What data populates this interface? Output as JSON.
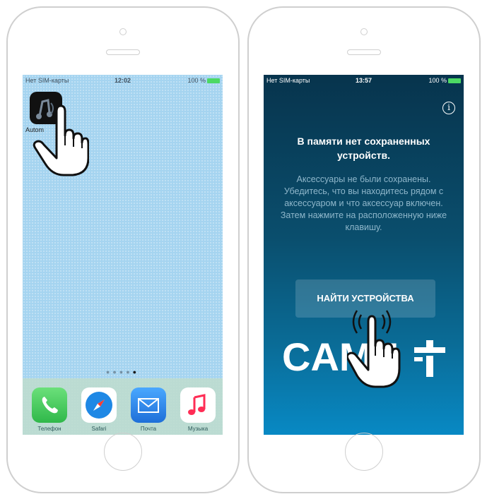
{
  "left_phone": {
    "status_bar": {
      "carrier": "Нет SIM-карты",
      "time": "12:02",
      "battery": "100 %"
    },
    "app_icon": {
      "label": "Autom",
      "icon": "music-app-icon"
    },
    "page_dots": {
      "count": 5,
      "active": 5
    },
    "dock": [
      {
        "label": "Телефон",
        "icon": "phone-icon",
        "color": "#4cd964"
      },
      {
        "label": "Safari",
        "icon": "compass-icon",
        "color": "#1e88e5"
      },
      {
        "label": "Почта",
        "icon": "envelope-icon",
        "color": "#2f8ef0"
      },
      {
        "label": "Музыка",
        "icon": "music-note-icon",
        "color": "#ff2d55"
      }
    ]
  },
  "right_phone": {
    "status_bar": {
      "carrier": "Нет SIM-карты",
      "time": "13:57",
      "battery": "100 %"
    },
    "heading": "В памяти нет сохраненных устройств.",
    "message": "Аксессуары не были сохранены. Убедитесь, что вы находитесь рядом с аксессуаром и что аксессуар включен. Затем нажмите на расположенную ниже клавишу.",
    "button_label": "НАЙТИ УСТРОЙСТВА",
    "logo_text": "CAME",
    "info_icon": "info-icon"
  }
}
